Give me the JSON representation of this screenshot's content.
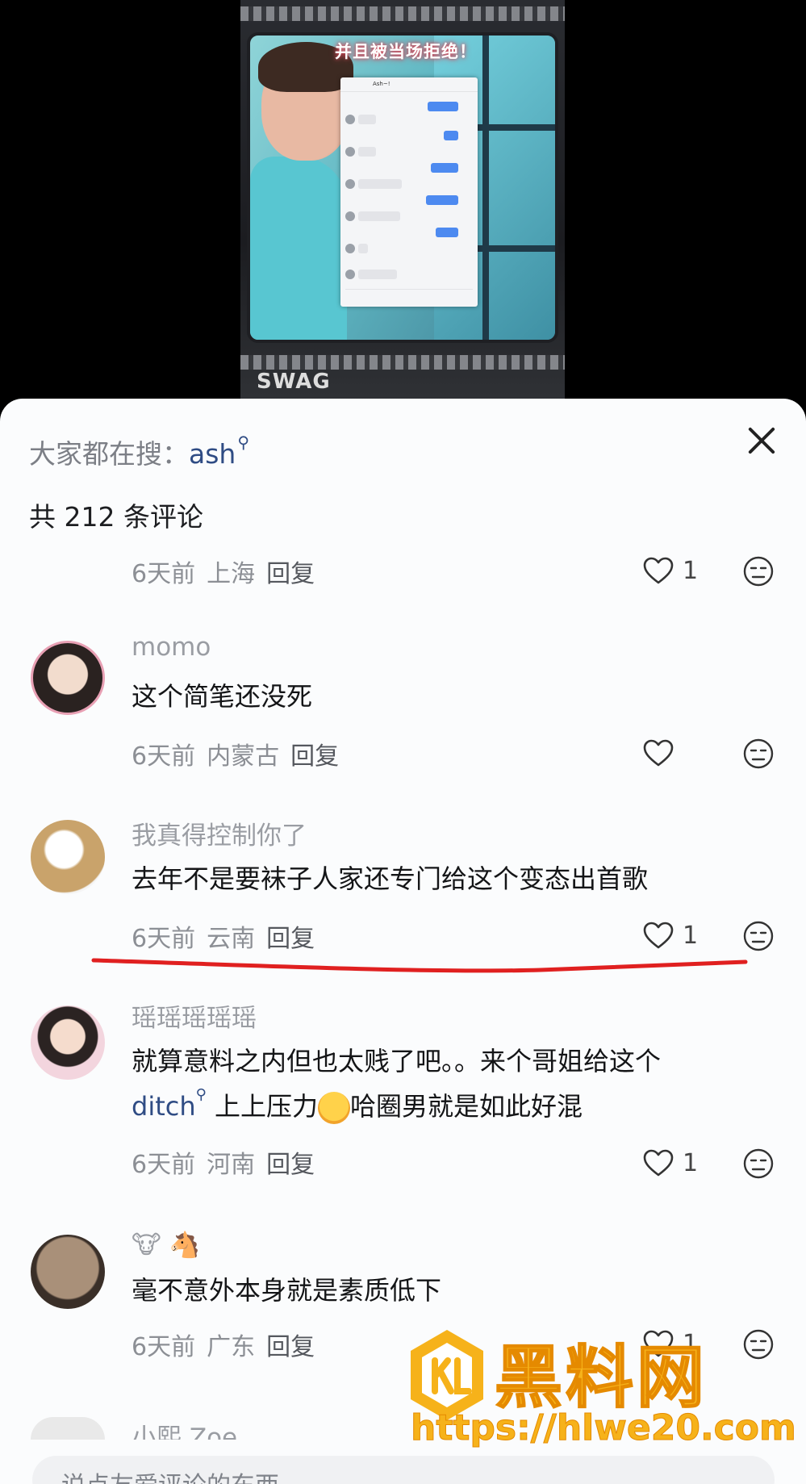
{
  "video": {
    "caption": "并且被当场拒绝！",
    "chat_title": "Ash~!",
    "sticker_text": "SWAG"
  },
  "comments_sheet": {
    "search_hint_prefix": "大家都在搜：",
    "search_keyword": "ash",
    "comment_count_label": "共 212 条评论",
    "comments": [
      {
        "time": "6天前",
        "location": "上海",
        "reply_label": "回复",
        "likes": "1"
      },
      {
        "username": "momo",
        "text": "这个简笔还没死",
        "time": "6天前",
        "location": "内蒙古",
        "reply_label": "回复",
        "likes": ""
      },
      {
        "username": "我真得控制你了",
        "text": "去年不是要袜子人家还专门给这个变态出首歌",
        "time": "6天前",
        "location": "云南",
        "reply_label": "回复",
        "likes": "1"
      },
      {
        "username": "瑶瑶瑶瑶瑶",
        "text": "就算意料之内但也太贱了吧。。来个哥姐给这个",
        "link": "ditch",
        "text2": " 上上压力",
        "text3": "哈圈男就是如此好混",
        "time": "6天前",
        "location": "河南",
        "reply_label": "回复",
        "likes": "1"
      },
      {
        "username_emoji": "🐮 🐴",
        "text": "毫不意外本身就是素质低下",
        "time": "6天前",
        "location": "广东",
        "reply_label": "回复",
        "likes": "1"
      },
      {
        "username": "小熙 Zoe"
      }
    ],
    "input_placeholder": "说点友爱评论的东西"
  },
  "watermark": {
    "title": "黑料网",
    "url": "https://hlwe20.com"
  },
  "colors": {
    "link": "#2f4c84",
    "underline_mark": "#e02020",
    "watermark": "#f6b21a"
  }
}
